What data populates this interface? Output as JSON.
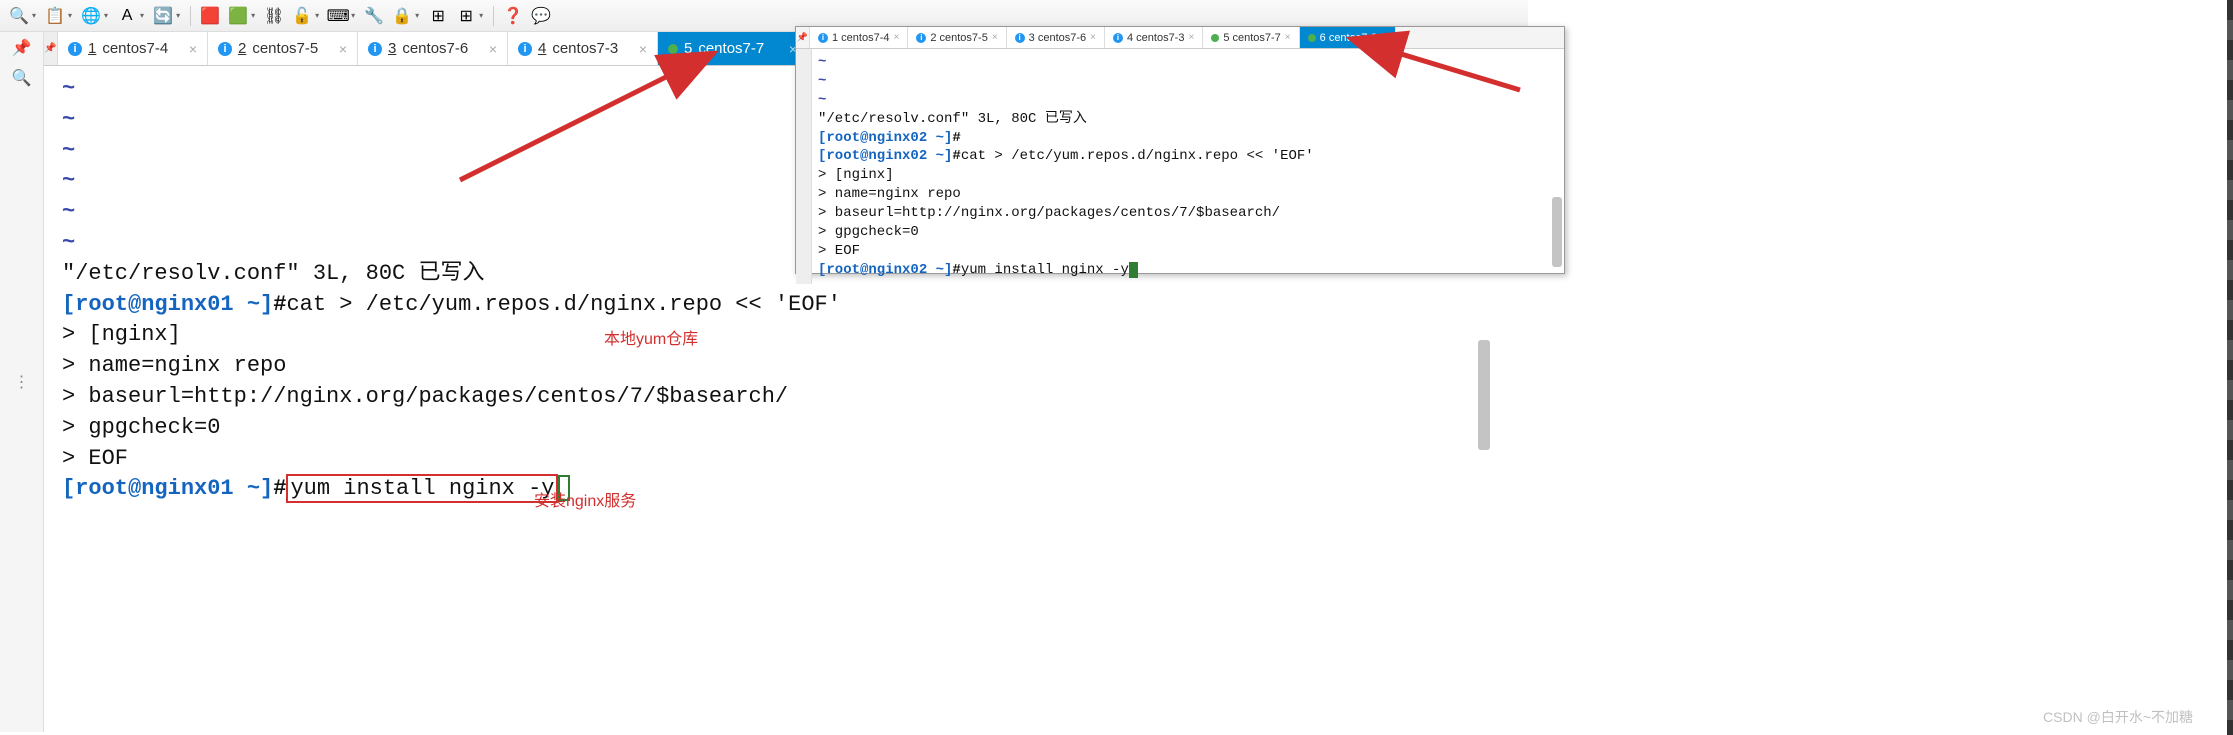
{
  "toolbar_icons": [
    "🔍",
    "📋",
    "🌐",
    "A",
    "🔄",
    "🟥",
    "🟩",
    "⛓",
    "🔓",
    "⌨",
    "🔧",
    "🔒",
    "⊞",
    "⊞",
    "❓",
    "💬"
  ],
  "main_tabs": [
    {
      "ico": "info",
      "num": "1",
      "label": "centos7-4",
      "active": false
    },
    {
      "ico": "info",
      "num": "2",
      "label": "centos7-5",
      "active": false
    },
    {
      "ico": "info",
      "num": "3",
      "label": "centos7-6",
      "active": false
    },
    {
      "ico": "info",
      "num": "4",
      "label": "centos7-3",
      "active": false
    },
    {
      "ico": "dot",
      "num": "5",
      "label": "centos7-7",
      "active": true
    }
  ],
  "main_term": {
    "tildes": 6,
    "line_file": "\"/etc/resolv.conf\" 3L, 80C 已写入",
    "prompt1_user": "[root@nginx01 ~]",
    "prompt1_hash": "#",
    "prompt1_cmd": "cat > /etc/yum.repos.d/nginx.repo << 'EOF'",
    "heredoc": [
      "> [nginx]",
      "> name=nginx repo",
      "> baseurl=http://nginx.org/packages/centos/7/$basearch/",
      "> gpgcheck=0",
      "> EOF"
    ],
    "prompt2_user": "[root@nginx01 ~]",
    "prompt2_hash": "#",
    "prompt2_cmd": "yum install nginx -y"
  },
  "anno1": "本地yum仓库",
  "anno2": "安装nginx服务",
  "win2_tabs": [
    {
      "ico": "info",
      "num": "1",
      "label": "centos7-4",
      "active": false
    },
    {
      "ico": "info",
      "num": "2",
      "label": "centos7-5",
      "active": false
    },
    {
      "ico": "info",
      "num": "3",
      "label": "centos7-6",
      "active": false
    },
    {
      "ico": "info",
      "num": "4",
      "label": "centos7-3",
      "active": false
    },
    {
      "ico": "dot",
      "num": "5",
      "label": "centos7-7",
      "active": false
    },
    {
      "ico": "dot",
      "num": "6",
      "label": "centos7-8",
      "active": true
    }
  ],
  "win2_term": {
    "tildes": 3,
    "line_file": "\"/etc/resolv.conf\" 3L, 80C 已写入",
    "p1_user": "[root@nginx02 ~]",
    "p1_hash": "#",
    "p1_cmd": "",
    "p2_user": "[root@nginx02 ~]",
    "p2_hash": "#",
    "p2_cmd": "cat > /etc/yum.repos.d/nginx.repo << 'EOF'",
    "heredoc": [
      "> [nginx]",
      "> name=nginx repo",
      "> baseurl=http://nginx.org/packages/centos/7/$basearch/",
      "> gpgcheck=0",
      "> EOF"
    ],
    "p3_user": "[root@nginx02 ~]",
    "p3_hash": "#",
    "p3_cmd": "yum install nginx -y"
  },
  "watermark": "CSDN @白开水~不加糖"
}
